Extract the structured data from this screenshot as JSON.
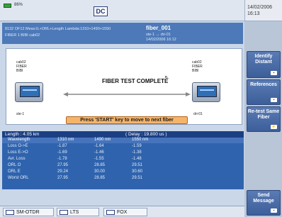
{
  "status": {
    "battery_pct": "86%",
    "date": "14/02/2006",
    "time": "16:13",
    "logo": "DC"
  },
  "info": {
    "line1": "8132 OF12     Meas:IL+ORL+Length   Lambda:1310+1490+1550",
    "line2": "FIBER 1  BIBI  cab02",
    "fiber_name": "fiber_001",
    "route": "ste-1 → dri-01",
    "timestamp": "14/02/2006  16:12"
  },
  "diagram": {
    "left": {
      "cable": "cab02",
      "fiber": "FIBER",
      "group": "BIBI",
      "site": "ste-1"
    },
    "right": {
      "cable": "cab02",
      "fiber": "FIBER",
      "group": "BIBI",
      "site": "dri-01"
    },
    "status_text": "FIBER TEST COMPLETE",
    "prompt": "Press 'START' key to move to next fiber"
  },
  "results": {
    "length": "Length : 4.05 km",
    "delay": "( Delay : 19.800 us )",
    "columns": [
      "Wavelength",
      "1310 nm",
      "1490 nm",
      "1550 nm"
    ],
    "rows": [
      [
        "Loss O->E",
        "-1.87",
        "-1.64",
        "-1.59"
      ],
      [
        "Loss E->O",
        "-1.69",
        "-1.46",
        "-1.38"
      ],
      [
        "Avr. Loss",
        "-1.78",
        "-1.55",
        "-1.48"
      ],
      [
        "ORL O",
        "27.95",
        "28.85",
        "29.51"
      ],
      [
        "ORL E",
        "29.24",
        "30.00",
        "30.60"
      ],
      [
        "Worst ORL",
        "27.95",
        "28.85",
        "29.51"
      ]
    ]
  },
  "side_buttons": [
    "Identify Distant",
    "References",
    "Re-test Same Fiber",
    "Send Message"
  ],
  "tabs": [
    "SM-OTDR",
    "LTS",
    "FOX"
  ]
}
